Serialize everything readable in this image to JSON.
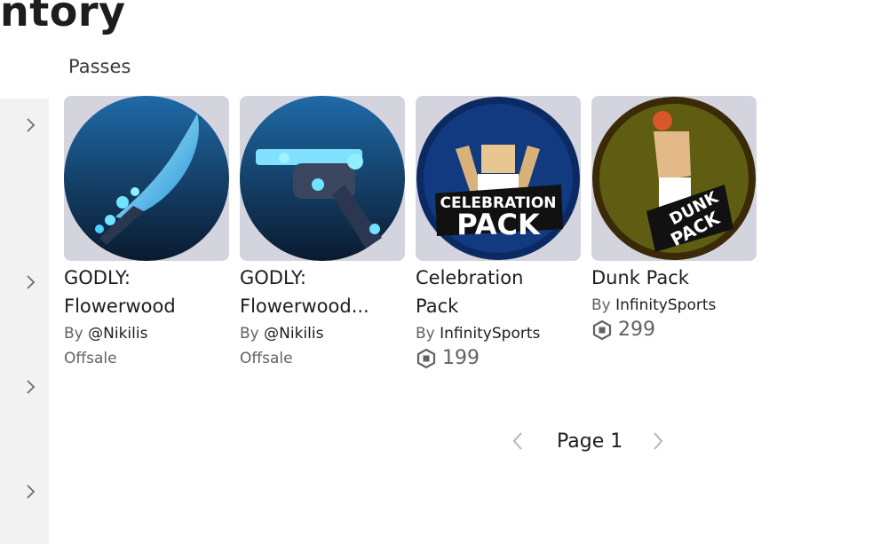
{
  "header": {
    "title": "ntory"
  },
  "section": {
    "label": "Passes"
  },
  "items": [
    {
      "name_line1": "GODLY:",
      "name_line2": "Flowerwood",
      "by_prefix": "By",
      "creator": "@Nikilis",
      "status": "Offsale",
      "price": null
    },
    {
      "name_line1": "GODLY:",
      "name_line2": "Flowerwood...",
      "by_prefix": "By",
      "creator": "@Nikilis",
      "status": "Offsale",
      "price": null
    },
    {
      "name_line1": "Celebration",
      "name_line2": "Pack",
      "by_prefix": "By",
      "creator": "InfinitySports",
      "status": null,
      "price": "199",
      "thumb_text1": "CELEBRATION",
      "thumb_text2": "PACK"
    },
    {
      "name_line1": "Dunk Pack",
      "name_line2": "",
      "by_prefix": "By",
      "creator": "InfinitySports",
      "status": null,
      "price": "299",
      "thumb_text1": "DUNK",
      "thumb_text2": "PACK"
    }
  ],
  "pager": {
    "label": "Page 1"
  },
  "icons": {
    "sidebar": "chevron-right-icon",
    "prev": "chevron-left-icon",
    "next": "chevron-right-icon",
    "currency": "robux-icon"
  },
  "colors": {
    "thumb_bg": "#d4d4de",
    "sidebar_bg": "#f2f2f3",
    "text_primary": "#1b1d1f",
    "text_secondary": "#5f6266"
  }
}
